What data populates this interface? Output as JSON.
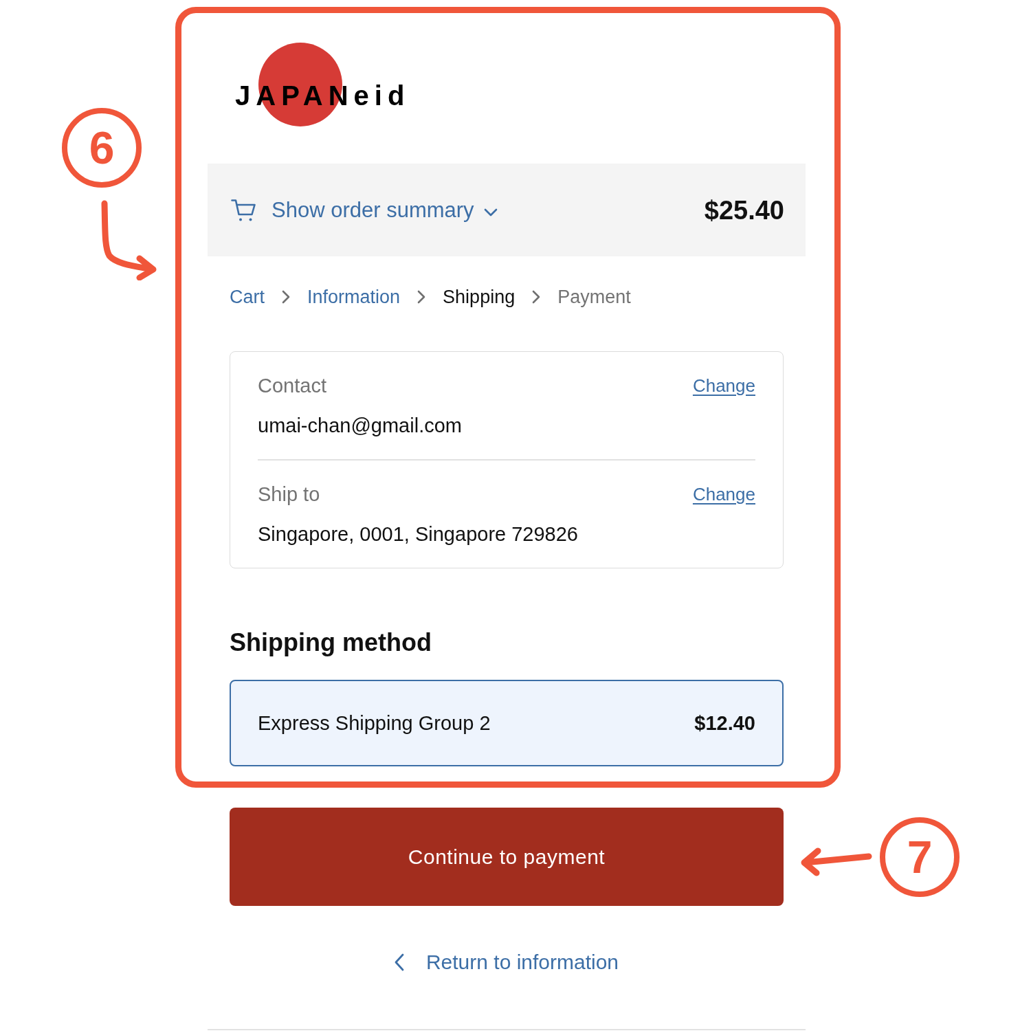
{
  "logo": {
    "text": "JAPANeid"
  },
  "order_summary": {
    "label": "Show order summary",
    "expanded": false,
    "total": "$25.40"
  },
  "breadcrumbs": [
    {
      "label": "Cart",
      "completed": true,
      "selected": false
    },
    {
      "label": "Information",
      "completed": true,
      "selected": false
    },
    {
      "label": "Shipping",
      "completed": false,
      "selected": true
    },
    {
      "label": "Payment",
      "completed": false,
      "selected": false
    }
  ],
  "review": [
    {
      "label": "Contact",
      "value": "umai-chan@gmail.com",
      "action": "Change"
    },
    {
      "label": "Ship to",
      "value": "Singapore, 0001, Singapore 729826",
      "action": "Change"
    }
  ],
  "shipping_method": {
    "heading": "Shipping method",
    "options": [
      {
        "label": "Express Shipping Group 2",
        "price": "$12.40",
        "selected": true
      }
    ]
  },
  "continue_button": "Continue to payment",
  "return_link": "Return to information",
  "annotations": [
    {
      "label": "6"
    },
    {
      "label": "7"
    }
  ]
}
